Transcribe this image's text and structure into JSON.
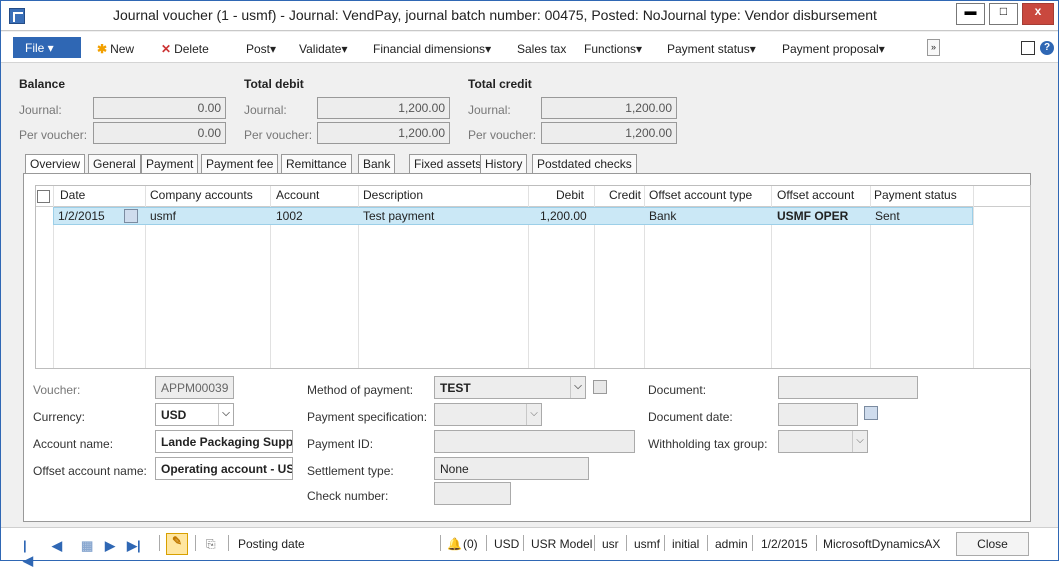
{
  "window": {
    "title": "Journal voucher (1 - usmf) - Journal: VendPay, journal batch number: 00475, Posted: NoJournal type: Vendor disbursement",
    "minimize": "▬",
    "maximize": "□",
    "close": "x"
  },
  "toolbar": {
    "file": "File",
    "new": "New",
    "delete": "Delete",
    "post": "Post",
    "validate": "Validate",
    "financial_dimensions": "Financial dimensions",
    "sales_tax": "Sales tax",
    "functions": "Functions",
    "payment_status": "Payment status",
    "payment_proposal": "Payment proposal",
    "more": "»",
    "help": "?"
  },
  "summary": {
    "balance": {
      "title": "Balance",
      "journal_label": "Journal:",
      "journal": "0.00",
      "per_voucher_label": "Per voucher:",
      "per_voucher": "0.00"
    },
    "total_debit": {
      "title": "Total debit",
      "journal_label": "Journal:",
      "journal": "1,200.00",
      "per_voucher_label": "Per voucher:",
      "per_voucher": "1,200.00"
    },
    "total_credit": {
      "title": "Total credit",
      "journal_label": "Journal:",
      "journal": "1,200.00",
      "per_voucher_label": "Per voucher:",
      "per_voucher": "1,200.00"
    }
  },
  "tabs": [
    "Overview",
    "General",
    "Payment",
    "Payment fee",
    "Remittance",
    "Bank",
    "Fixed assets",
    "History",
    "Postdated checks"
  ],
  "grid": {
    "headers": [
      "Date",
      "Company accounts",
      "Account",
      "Description",
      "Debit",
      "Credit",
      "Offset account type",
      "Offset account",
      "Payment status"
    ],
    "rows": [
      [
        "1/2/2015",
        "usmf",
        "1002",
        "Test payment",
        "1,200.00",
        "",
        "Bank",
        "USMF OPER",
        "Sent"
      ]
    ]
  },
  "details": {
    "voucher_label": "Voucher:",
    "voucher": "APPM00039",
    "currency_label": "Currency:",
    "currency": "USD",
    "account_name_label": "Account name:",
    "account_name": "Lande Packaging Suppl",
    "offset_account_name_label": "Offset account name:",
    "offset_account_name": "Operating account - US",
    "method_of_payment_label": "Method of payment:",
    "method_of_payment": "TEST",
    "payment_specification_label": "Payment specification:",
    "payment_specification": "",
    "payment_id_label": "Payment ID:",
    "payment_id": "",
    "settlement_type_label": "Settlement type:",
    "settlement_type": "None",
    "check_number_label": "Check number:",
    "check_number": "",
    "document_label": "Document:",
    "document": "",
    "document_date_label": "Document date:",
    "document_date": "",
    "withholding_tax_group_label": "Withholding tax group:",
    "withholding_tax_group": ""
  },
  "statusbar": {
    "posting_date": "Posting date",
    "alerts": "(0)",
    "currency": "USD",
    "model": "USR Model",
    "user": "usr",
    "company": "usmf",
    "layer": "initial",
    "partition": "admin",
    "date": "1/2/2015",
    "application": "MicrosoftDynamicsAX",
    "close": "Close"
  }
}
